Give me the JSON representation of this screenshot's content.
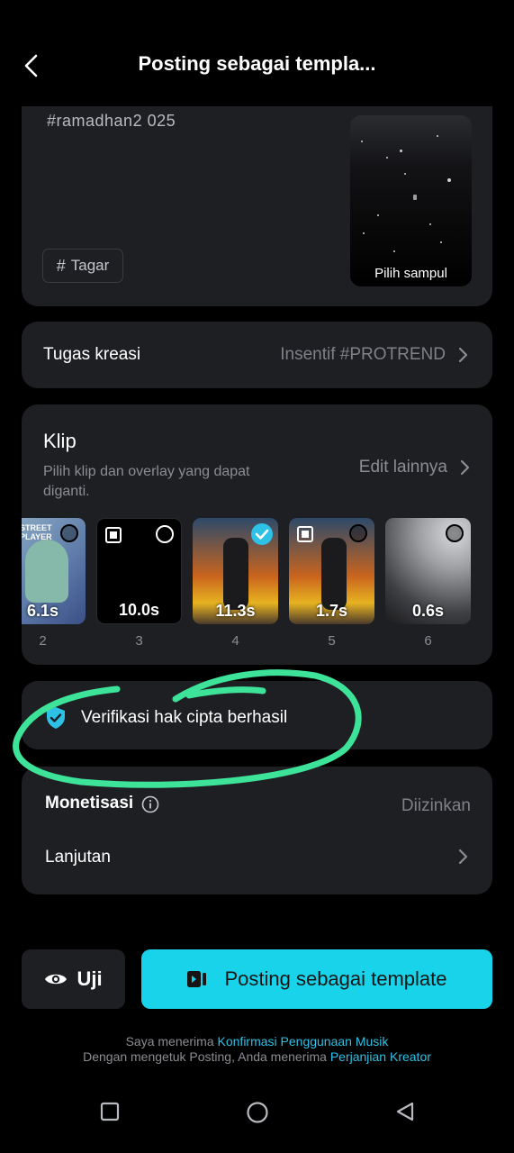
{
  "header": {
    "title": "Posting sebagai templa..."
  },
  "details": {
    "hashtags": "#ramadhan2 025",
    "tag_button": "Tagar",
    "cover_label": "Pilih sampul"
  },
  "task": {
    "label": "Tugas kreasi",
    "value": "Insentif #PROTREND"
  },
  "clips": {
    "title": "Klip",
    "subtitle_line1": "Pilih klip dan overlay yang dapat",
    "subtitle_line2": "diganti.",
    "edit_more": "Edit lainnya",
    "items": [
      {
        "duration": "6.1s",
        "number": "2",
        "thumb_text": "STREET PLAYER",
        "selected": false
      },
      {
        "duration": "10.0s",
        "number": "3",
        "selected": false
      },
      {
        "duration": "11.3s",
        "number": "4",
        "selected": true
      },
      {
        "duration": "1.7s",
        "number": "5",
        "selected": false
      },
      {
        "duration": "0.6s",
        "number": "6",
        "selected": false
      }
    ]
  },
  "copyright": {
    "text": "Verifikasi hak cipta berhasil"
  },
  "settings": {
    "monetization_label": "Monetisasi",
    "monetization_value": "Diizinkan",
    "advanced_label": "Lanjutan"
  },
  "actions": {
    "test_label": "Uji",
    "post_label": "Posting sebagai template"
  },
  "legal": {
    "line1_prefix": "Saya menerima",
    "line1_link": "Konfirmasi Penggunaan Musik",
    "line2_prefix": "Dengan mengetuk Posting, Anda menerima",
    "line2_link": "Perjanjian Kreator"
  },
  "colors": {
    "accent": "#19d3ea",
    "card": "#1e1f23",
    "annotation": "#3ee39a"
  }
}
